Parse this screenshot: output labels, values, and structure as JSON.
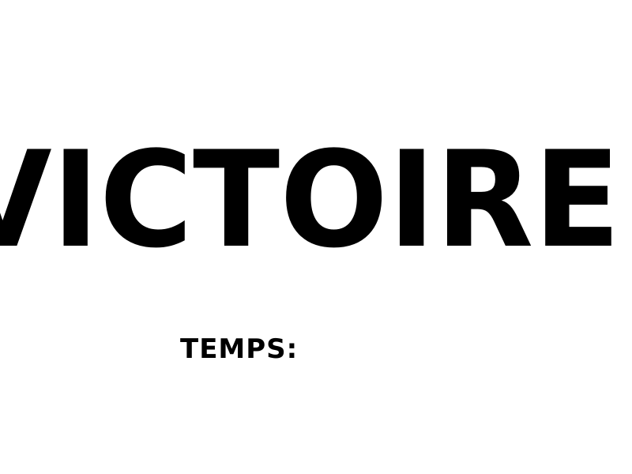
{
  "victory": {
    "title": "VICTOIRE!"
  },
  "timer": {
    "label": "TEMPS:",
    "value": ""
  },
  "colors": {
    "background": "#ffffff",
    "text": "#000000"
  }
}
